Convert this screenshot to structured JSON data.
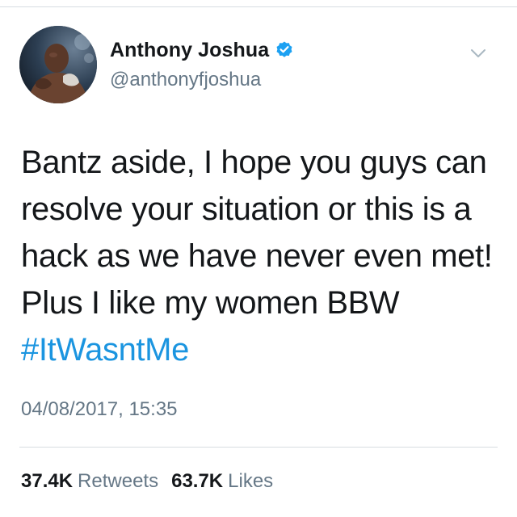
{
  "tweet": {
    "author": {
      "display_name": "Anthony Joshua",
      "handle": "@anthonyfjoshua",
      "verified": true
    },
    "text_lines": [
      "Bantz aside, I hope you guys can",
      "resolve your situation or this is a",
      "hack as we have never even met!",
      "Plus I like my women BBW"
    ],
    "hashtag": "#ItWasntMe",
    "timestamp": "04/08/2017, 15:35",
    "stats": {
      "retweets_count": "37.4K",
      "retweets_label": "Retweets",
      "likes_count": "63.7K",
      "likes_label": "Likes"
    }
  },
  "icons": {
    "verified": "verified-badge-icon",
    "menu": "chevron-down-icon"
  },
  "colors": {
    "text": "#14171a",
    "secondary": "#657786",
    "link": "#1b95e0",
    "verified": "#1da1f2",
    "divider": "#d7dde2"
  }
}
